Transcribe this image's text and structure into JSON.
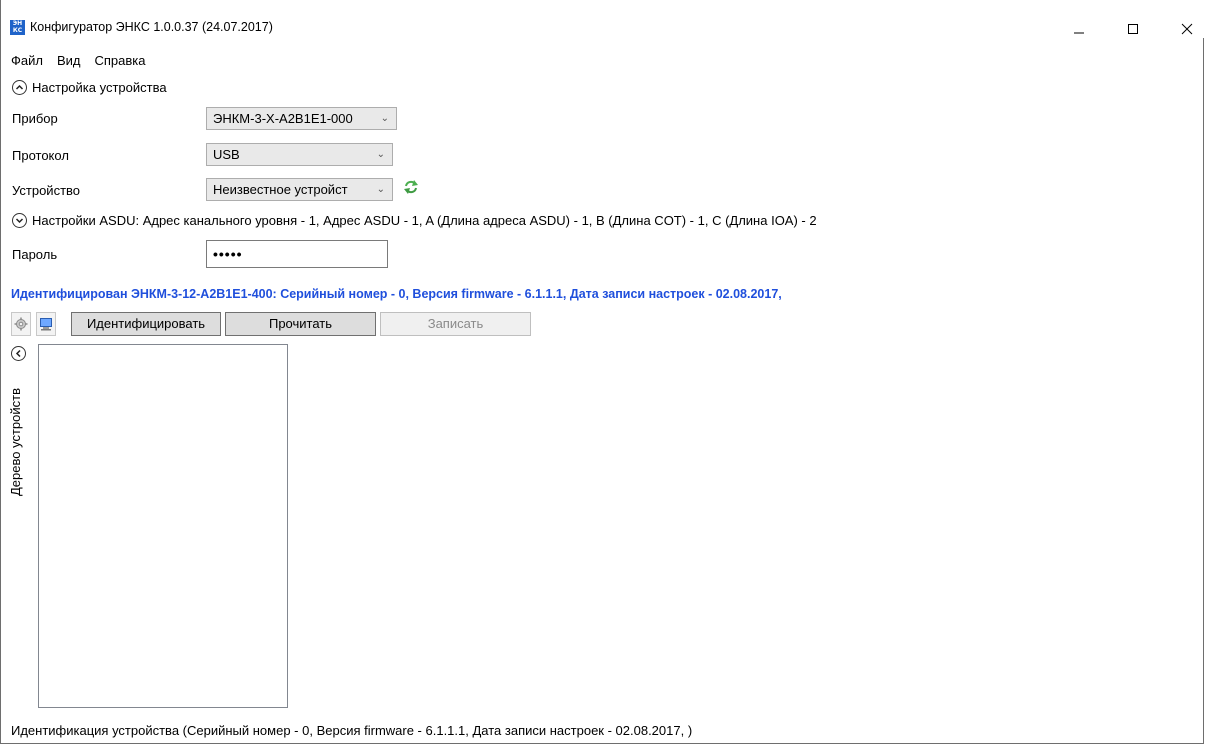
{
  "window": {
    "title": "Конфигуратор ЭНКС 1.0.0.37 (24.07.2017)",
    "icon_text_top": "ЭН",
    "icon_text_bottom": "КС"
  },
  "menu": {
    "items": [
      "Файл",
      "Вид",
      "Справка"
    ]
  },
  "device_settings": {
    "header": "Настройка устройства",
    "device_label": "Прибор",
    "device_value": "ЭНКМ-3-Х-А2В1Е1-000",
    "protocol_label": "Протокол",
    "protocol_value": "USB",
    "port_label": "Устройство",
    "port_value": "Неизвестное устройст"
  },
  "asdu": {
    "header": "Настройки ASDU: Адрес канального уровня - 1, Адрес ASDU - 1, A (Длина адреса ASDU) - 1, B (Длина COT) - 1, C (Длина IOA) - 2"
  },
  "password": {
    "label": "Пароль",
    "value": "•••••"
  },
  "identification_line": "Идентифицирован ЭНКМ-3-12-А2В1Е1-400: Серийный номер - 0, Версия firmware - 6.1.1.1, Дата записи настроек - 02.08.2017,",
  "toolbar": {
    "identify_label": "Идентифицировать",
    "read_label": "Прочитать",
    "write_label": "Записать"
  },
  "tree": {
    "vertical_label": "Дерево устройств"
  },
  "status_bar": {
    "text": "Идентификация устройства (Серийный номер - 0, Версия firmware - 6.1.1.1, Дата записи настроек - 02.08.2017, )"
  },
  "colors": {
    "identification_text": "#1f4fdc",
    "app_icon": "#1f63c9",
    "refresh_icon": "#4caf50"
  },
  "icons": {
    "app": "enks-logo-icon",
    "minimize": "minimize-icon",
    "maximize": "maximize-icon",
    "close": "close-icon",
    "collapse": "chevron-up-circle-icon",
    "expand": "chevron-down-circle-icon",
    "refresh": "refresh-icon",
    "settings": "gear-icon",
    "computer": "computer-icon",
    "tree_collapse": "chevron-left-circle-icon"
  }
}
